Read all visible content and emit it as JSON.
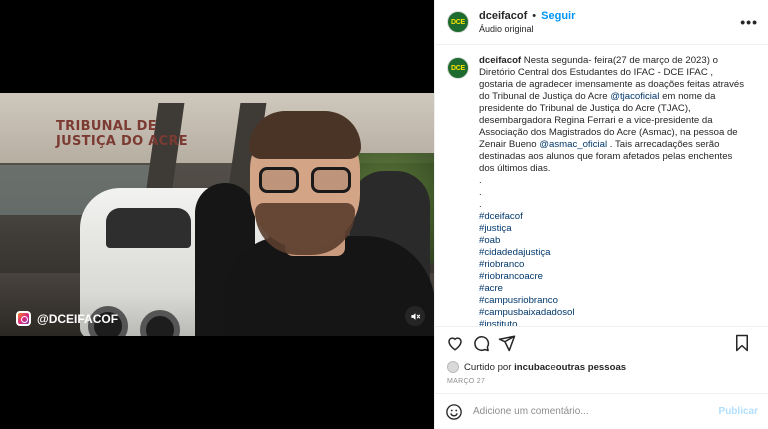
{
  "video": {
    "overlay_text": "TRIBUNAL DE JUSTIÇA DO ACRE",
    "handle": "@DCEIFACOF"
  },
  "account": {
    "avatar_text": "DCE",
    "username": "dceifacof",
    "separator": "•",
    "follow_label": "Seguir",
    "audio_label": "Áudio original",
    "more_label": "•••"
  },
  "caption": {
    "username": "dceifacof",
    "text_1": " Nesta segunda- feira(27 de março de 2023) o Diretório Central dos Estudantes do IFAC - DCE IFAC , gostaria de agradecer imensamente as doações feitas através do Tribunal de Justiça do Acre ",
    "mention_1": "@tjacoficial",
    "text_2": " em nome da presidente do Tribunal de Justiça do Acre (TJAC), desembargadora Regina Ferrari e a vice-presidente da Associação dos Magistrados do Acre (Asmac), na pessoa de Zenair Bueno ",
    "mention_2": "@asmac_oficial",
    "text_3": " . Tais arrecadações serão destinadas aos alunos que foram afetados pelas enchentes dos últimos dias.",
    "dots": [
      ".",
      ".",
      "."
    ],
    "hashtags": [
      "#dceifacof",
      "#justiça",
      "#oab",
      "#cidadedajustiça",
      "#riobranco",
      "#riobrancoacre",
      "#acre",
      "#campusriobranco",
      "#campusbaixadadosol",
      "#instituto"
    ]
  },
  "likes": {
    "prefix": "Curtido por ",
    "user": "incubac",
    "suffix": " e ",
    "others": "outras pessoas"
  },
  "date": "MARÇO 27",
  "comment": {
    "placeholder": "Adicione um comentário...",
    "post_label": "Publicar"
  },
  "colors": {
    "link": "#0095f6",
    "mention": "#00376b",
    "post_disabled": "#b2dffc",
    "avatar_bg": "#1e6b2f",
    "avatar_text": "#f5e400"
  }
}
